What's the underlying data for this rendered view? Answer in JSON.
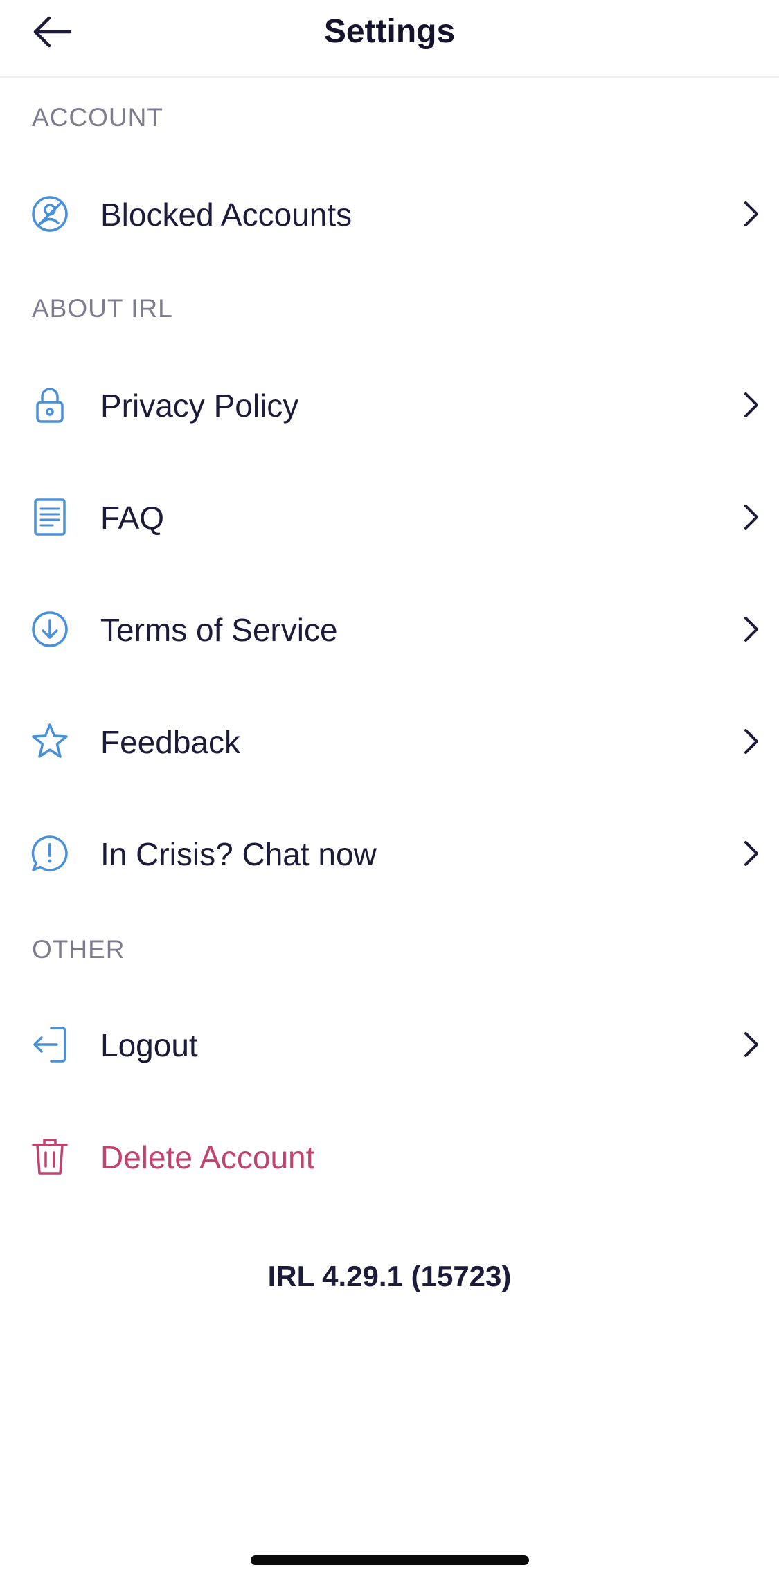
{
  "header": {
    "title": "Settings",
    "back_icon": "arrow-left-icon"
  },
  "sections": {
    "account": "ACCOUNT",
    "about": "ABOUT IRL",
    "other": "OTHER"
  },
  "items": {
    "blocked": {
      "label": "Blocked Accounts",
      "icon": "blocked-user-icon"
    },
    "privacy": {
      "label": "Privacy Policy",
      "icon": "lock-icon"
    },
    "faq": {
      "label": "FAQ",
      "icon": "document-icon"
    },
    "terms": {
      "label": "Terms of Service",
      "icon": "download-circle-icon"
    },
    "feedback": {
      "label": "Feedback",
      "icon": "star-icon"
    },
    "crisis": {
      "label": "In Crisis? Chat now",
      "icon": "alert-chat-icon"
    },
    "logout": {
      "label": "Logout",
      "icon": "logout-icon"
    },
    "delete": {
      "label": "Delete Account",
      "icon": "trash-icon"
    }
  },
  "version": "IRL 4.29.1 (15723)",
  "colors": {
    "icon_accent": "#4a90d9",
    "danger": "#c2426d",
    "section_header": "#7d7c8f",
    "text": "#1c1b3a"
  }
}
